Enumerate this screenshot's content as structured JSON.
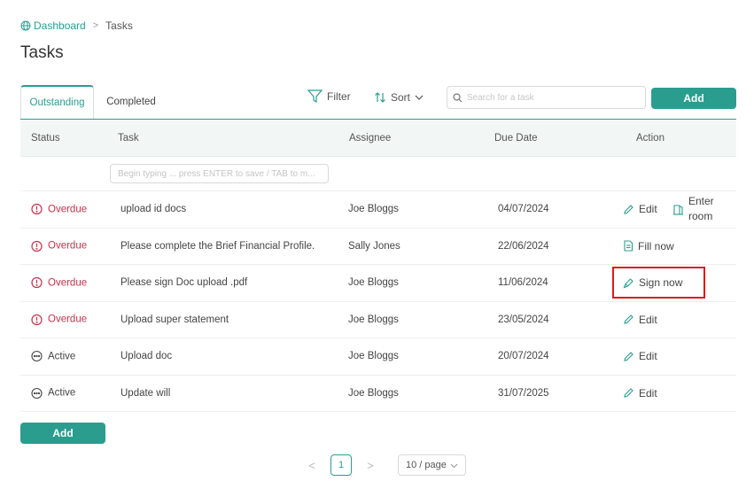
{
  "breadcrumb": {
    "home": "Dashboard",
    "separator": ">",
    "current": "Tasks"
  },
  "page_title": "Tasks",
  "tabs": [
    {
      "label": "Outstanding",
      "active": true
    },
    {
      "label": "Completed",
      "active": false
    }
  ],
  "toolbar": {
    "filter_label": "Filter",
    "sort_label": "Sort",
    "search_placeholder": "Search for a task",
    "add_label": "Add"
  },
  "table": {
    "columns": [
      "Status",
      "Task",
      "Assignee",
      "Due Date",
      "Action"
    ],
    "new_task_placeholder": "Begin typing ... press ENTER to save / TAB to m...",
    "rows": [
      {
        "status": "Overdue",
        "task": "upload id docs",
        "assignee": "Joe Bloggs",
        "due": "04/07/2024",
        "action": "Edit",
        "action2": "Enter room"
      },
      {
        "status": "Overdue",
        "task": "Please complete the Brief Financial Profile.",
        "assignee": "Sally Jones",
        "due": "22/06/2024",
        "action": "Fill now"
      },
      {
        "status": "Overdue",
        "task": "Please sign Doc upload .pdf",
        "assignee": "Joe Bloggs",
        "due": "11/06/2024",
        "action": "Sign now"
      },
      {
        "status": "Overdue",
        "task": "Upload super statement",
        "assignee": "Joe Bloggs",
        "due": "23/05/2024",
        "action": "Edit"
      },
      {
        "status": "Active",
        "task": "Upload doc",
        "assignee": "Joe Bloggs",
        "due": "20/07/2024",
        "action": "Edit"
      },
      {
        "status": "Active",
        "task": "Update will",
        "assignee": "Joe Bloggs",
        "due": "31/07/2025",
        "action": "Edit"
      }
    ]
  },
  "bottom": {
    "add_label": "Add"
  },
  "pagination": {
    "prev": "<",
    "current_page": "1",
    "next": ">",
    "page_size": "10 / page"
  },
  "colors": {
    "accent": "#2a9d8f",
    "overdue": "#c8314a",
    "highlight": "#e0191b"
  }
}
